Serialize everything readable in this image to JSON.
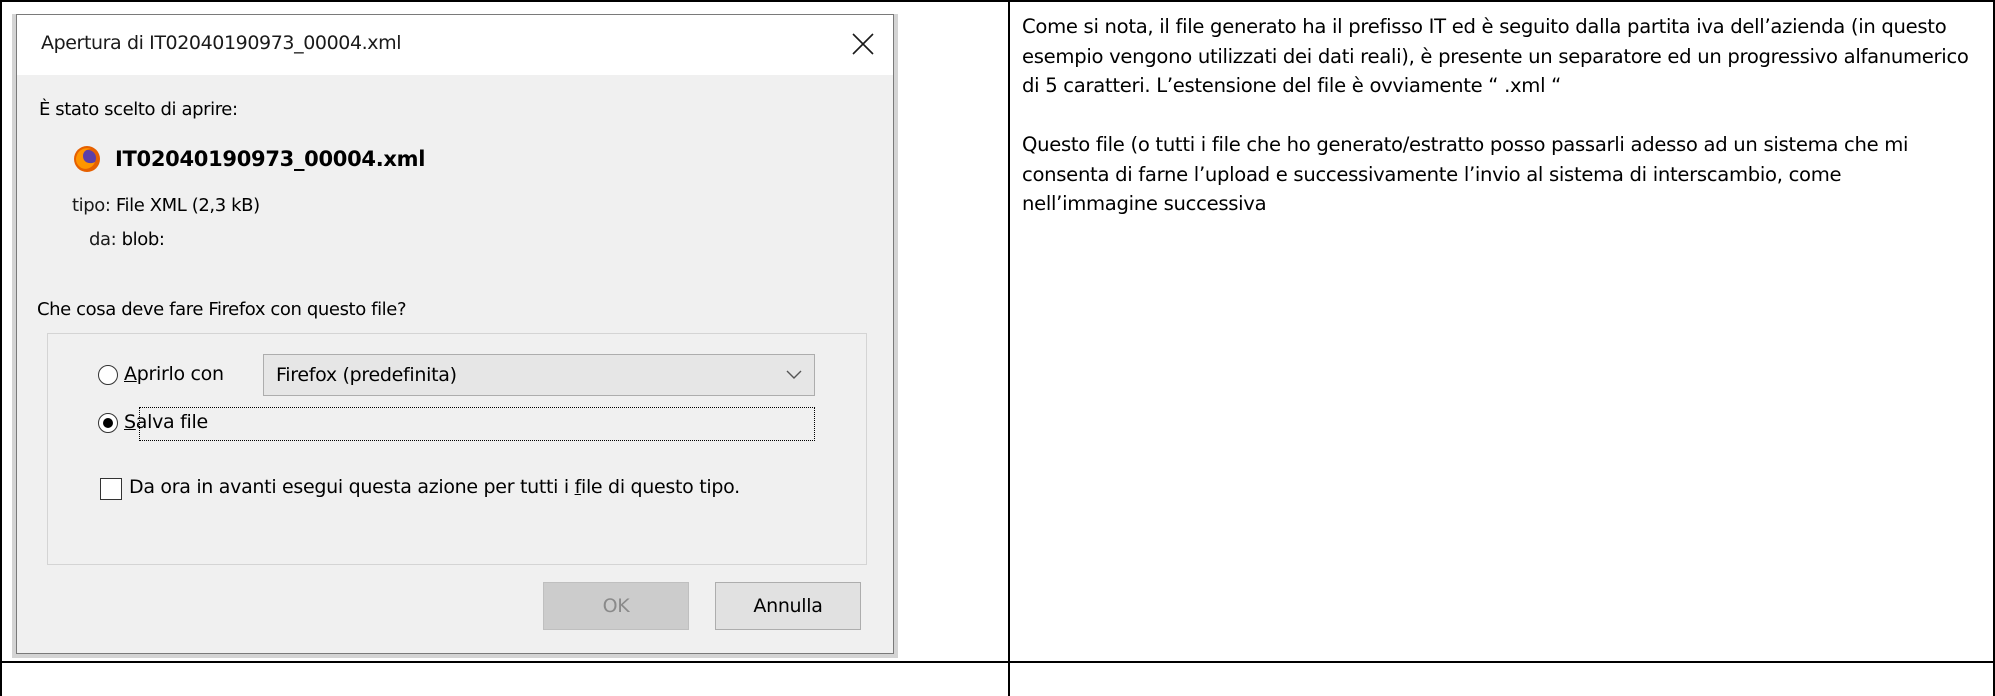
{
  "document": {
    "paragraphs": [
      "Come si nota, il file generato ha il prefisso  IT ed è seguito dalla partita iva dell’azienda (in questo esempio vengono utilizzati dei dati reali), è presente un separatore ed un progressivo alfanumerico di 5 caratteri. L’estensione del file è ovviamente “ .xml “",
      "Questo file (o tutti i file che ho generato/estratto posso passarli adesso ad un sistema che mi consenta di farne l’upload e successivamente l’invio al sistema di interscambio, come nell’immagine successiva"
    ]
  },
  "dialog": {
    "title": "Apertura di IT02040190973_00004.xml",
    "chosen_label": "È stato scelto di aprire:",
    "file_name": "IT02040190973_00004.xml",
    "type_key": "tipo:",
    "type_value": "File XML (2,3 kB)",
    "from_key": "da:",
    "from_value": "blob:",
    "question": "Che cosa deve fare Firefox con questo file?",
    "open_with": {
      "accel": "A",
      "rest": "prirlo con"
    },
    "open_with_app": "Firefox (predefinita)",
    "save_file": {
      "accel": "S",
      "rest": "alva file"
    },
    "remember": {
      "before": "Da ora in avanti esegui questa azione per tutti i ",
      "accel": "f",
      "after": "ile di questo tipo."
    },
    "ok_label": "OK",
    "cancel_label": "Annulla",
    "selected_option": "save_file",
    "remember_checked": false
  },
  "icons": {
    "close": "close-icon",
    "firefox": "firefox-icon",
    "dropdown": "chevron-down-icon"
  },
  "colors": {
    "dialog_bg": "#f0f0f0",
    "titlebar_bg": "#ffffff",
    "ok_disabled_bg": "#cccccc",
    "button_bg": "#e1e1e1"
  }
}
